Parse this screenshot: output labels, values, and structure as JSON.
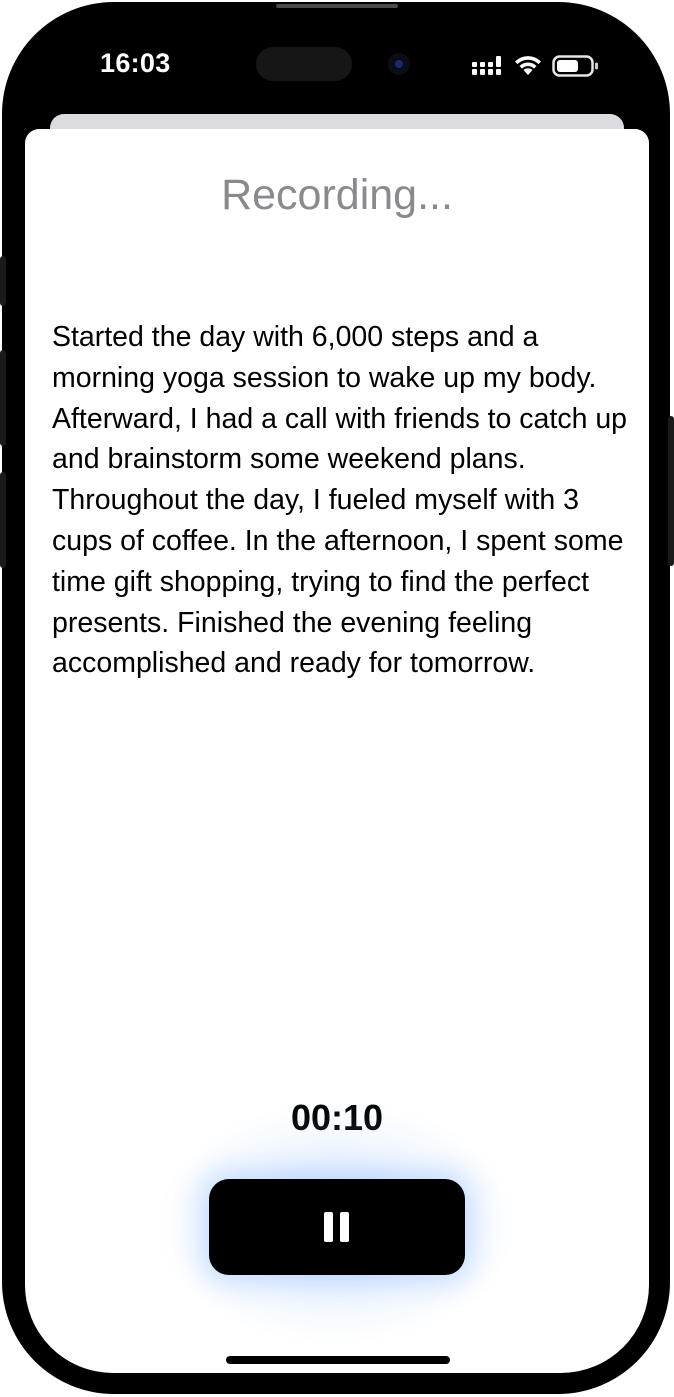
{
  "status_bar": {
    "time": "16:03",
    "icons": [
      "cellular-signal-icon",
      "wifi-icon",
      "battery-icon"
    ]
  },
  "recording": {
    "title": "Recording...",
    "transcript": "Started the day with 6,000 steps and a morning yoga session to wake up my body. Afterward, I had a call with friends to catch up and brainstorm some weekend plans. Throughout the day, I fueled myself with 3 cups of coffee. In the afternoon, I spent some time gift shopping, trying to find the perfect presents. Finished the evening feeling accomplished and ready for tomorrow.",
    "timer": "00:10"
  },
  "controls": {
    "pause_icon": "pause-icon"
  },
  "colors": {
    "title_gray": "#8a8a8e",
    "button_bg": "#000000",
    "glow_blue": "#78aaff"
  }
}
